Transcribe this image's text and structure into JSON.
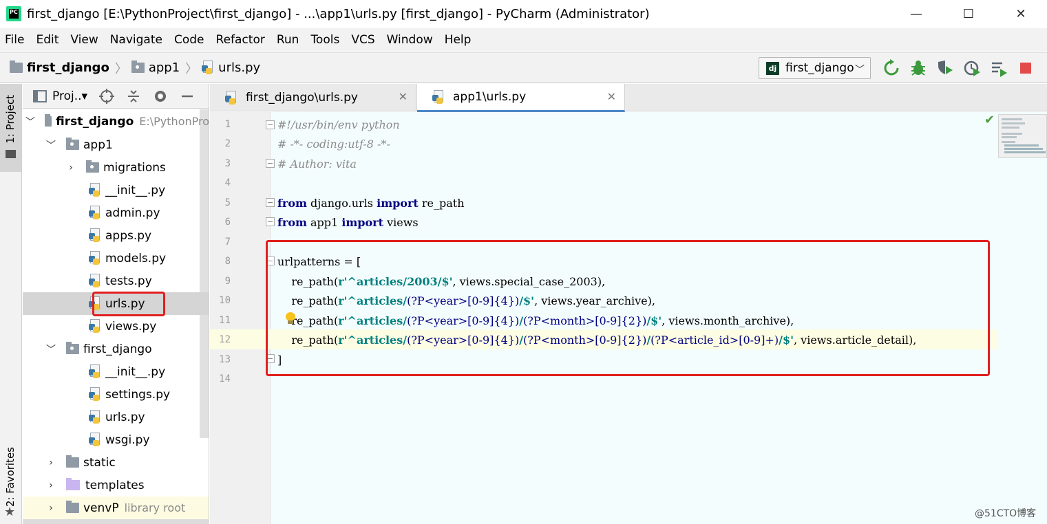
{
  "window": {
    "title": "first_django [E:\\PythonProject\\first_django] - ...\\app1\\urls.py [first_django] - PyCharm (Administrator)",
    "app_icon_text": "PC",
    "controls": {
      "minimize": "—",
      "maximize": "☐",
      "close": "✕"
    }
  },
  "menu": [
    "File",
    "Edit",
    "View",
    "Navigate",
    "Code",
    "Refactor",
    "Run",
    "Tools",
    "VCS",
    "Window",
    "Help"
  ],
  "breadcrumb": [
    "first_django",
    "app1",
    "urls.py"
  ],
  "run_config": {
    "icon_text": "dj",
    "label": "first_django"
  },
  "side_tabs": {
    "project": "1: Project",
    "favorites": "2: Favorites"
  },
  "project_panel": {
    "title": "Proj..▾"
  },
  "tree": [
    {
      "label": "first_django",
      "hint": "E:\\PythonPro",
      "kind": "root"
    },
    {
      "label": "app1",
      "kind": "folder"
    },
    {
      "label": "migrations",
      "kind": "folder"
    },
    {
      "label": "__init__.py",
      "kind": "py"
    },
    {
      "label": "admin.py",
      "kind": "py"
    },
    {
      "label": "apps.py",
      "kind": "py"
    },
    {
      "label": "models.py",
      "kind": "py"
    },
    {
      "label": "tests.py",
      "kind": "py"
    },
    {
      "label": "urls.py",
      "kind": "py"
    },
    {
      "label": "views.py",
      "kind": "py"
    },
    {
      "label": "first_django",
      "kind": "folder"
    },
    {
      "label": "__init__.py",
      "kind": "py"
    },
    {
      "label": "settings.py",
      "kind": "py"
    },
    {
      "label": "urls.py",
      "kind": "py"
    },
    {
      "label": "wsgi.py",
      "kind": "py"
    },
    {
      "label": "static",
      "kind": "folder"
    },
    {
      "label": "templates",
      "kind": "template"
    },
    {
      "label": "venvP",
      "hint": "library root",
      "kind": "folder"
    }
  ],
  "tabs": [
    {
      "label": "first_django\\urls.py"
    },
    {
      "label": "app1\\urls.py"
    }
  ],
  "line_numbers": [
    "1",
    "2",
    "3",
    "4",
    "5",
    "6",
    "7",
    "8",
    "9",
    "10",
    "11",
    "12",
    "13",
    "14"
  ],
  "code": {
    "l1": "#!/usr/bin/env python",
    "l2": "# -*- coding:utf-8 -*-",
    "l3": "# Author: vita",
    "l5_kw1": "from",
    "l5_mod": " django.urls ",
    "l5_kw2": "import",
    "l5_name": " re_path",
    "l6_kw1": "from",
    "l6_mod": " app1 ",
    "l6_kw2": "import",
    "l6_name": " views",
    "l8": "urlpatterns = [",
    "l9_a": "    re_path(",
    "l9_s": "r'^articles/2003/$'",
    "l9_b": ", views.special_case_2003),",
    "l10_a": "    re_path(",
    "l10_s1": "r'^articles/",
    "l10_rx": "(?P<year>[0-9]{4})",
    "l10_s2": "/$'",
    "l10_b": ", views.year_archive),",
    "l11_a": "    re_path(",
    "l11_s1": "r'^articles/",
    "l11_rx1": "(?P<year>[0-9]{4})",
    "l11_s2": "/",
    "l11_rx2": "(?P<month>[0-9]{2})",
    "l11_s3": "/$'",
    "l11_b": ", views.month_archive),",
    "l12_a": "    re_path(",
    "l12_s1": "r'^articles/",
    "l12_rx1": "(?P<year>[0-9]{4})",
    "l12_s2": "/",
    "l12_rx2": "(?P<month>[0-9]{2})",
    "l12_s3": "/",
    "l12_rx3": "(?P<article_id>[0-9]+)",
    "l12_s4": "/$'",
    "l12_b": ", views.article_detail),",
    "l13": "]"
  },
  "watermark": "@51CTO博客",
  "colors": {
    "highlight_box": "#e01f1f",
    "keyword": "#000080",
    "string": "#008080",
    "comment": "#8c8c8c"
  }
}
